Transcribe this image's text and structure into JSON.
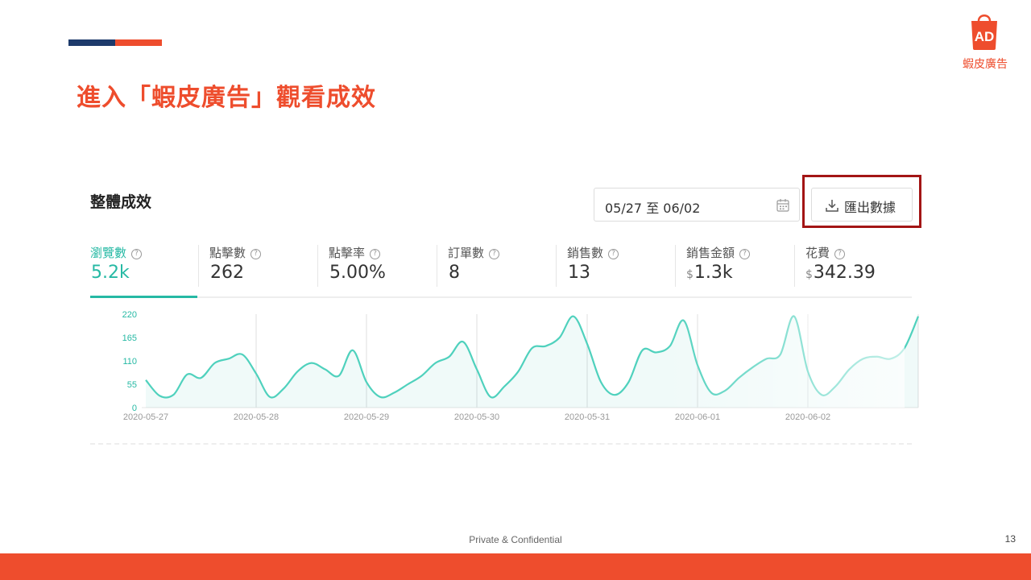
{
  "slide": {
    "title": "進入「蝦皮廣告」觀看成效",
    "logo_text": "AD",
    "logo_brand": "蝦皮廣告",
    "footer": "Private & Confidential",
    "page_number": "13",
    "colors": {
      "accent": "#ee4d2d",
      "navy": "#1d3a6b",
      "teal": "#26b9a4",
      "highlight": "#a31515"
    }
  },
  "panel": {
    "title": "整體成效",
    "date_range": "05/27 至 06/02",
    "export_label": "匯出數據",
    "icons": {
      "date": "calendar-icon",
      "export": "download-icon",
      "help": "help-circle-icon"
    }
  },
  "metrics": [
    {
      "label": "瀏覽數",
      "value": "5.2k",
      "currency": "",
      "active": true
    },
    {
      "label": "點擊數",
      "value": "262",
      "currency": "",
      "active": false
    },
    {
      "label": "點擊率",
      "value": "5.00%",
      "currency": "",
      "active": false
    },
    {
      "label": "訂單數",
      "value": "8",
      "currency": "",
      "active": false
    },
    {
      "label": "銷售數",
      "value": "13",
      "currency": "",
      "active": false
    },
    {
      "label": "銷售金額",
      "value": "1.3k",
      "currency": "$",
      "active": false
    },
    {
      "label": "花費",
      "value": "342.39",
      "currency": "$",
      "active": false
    }
  ],
  "chart_data": {
    "type": "area",
    "title": "",
    "xlabel": "",
    "ylabel": "",
    "ylim": [
      0,
      220
    ],
    "yticks": [
      0,
      55,
      110,
      165,
      220
    ],
    "xticks": [
      "2020-05-27",
      "2020-05-28",
      "2020-05-29",
      "2020-05-30",
      "2020-05-31",
      "2020-06-01",
      "2020-06-02"
    ],
    "grid": "vertical",
    "x": [
      "2020-05-27 00:00",
      "2020-05-27 03:00",
      "2020-05-27 06:00",
      "2020-05-27 09:00",
      "2020-05-27 12:00",
      "2020-05-27 15:00",
      "2020-05-27 18:00",
      "2020-05-27 21:00",
      "2020-05-28 00:00",
      "2020-05-28 03:00",
      "2020-05-28 06:00",
      "2020-05-28 09:00",
      "2020-05-28 12:00",
      "2020-05-28 15:00",
      "2020-05-28 18:00",
      "2020-05-28 21:00",
      "2020-05-29 00:00",
      "2020-05-29 03:00",
      "2020-05-29 06:00",
      "2020-05-29 09:00",
      "2020-05-29 12:00",
      "2020-05-29 15:00",
      "2020-05-29 18:00",
      "2020-05-29 21:00",
      "2020-05-30 00:00",
      "2020-05-30 03:00",
      "2020-05-30 06:00",
      "2020-05-30 09:00",
      "2020-05-30 12:00",
      "2020-05-30 15:00",
      "2020-05-30 18:00",
      "2020-05-30 21:00",
      "2020-05-31 00:00",
      "2020-05-31 03:00",
      "2020-05-31 06:00",
      "2020-05-31 09:00",
      "2020-05-31 12:00",
      "2020-05-31 15:00",
      "2020-05-31 18:00",
      "2020-05-31 21:00",
      "2020-06-01 00:00",
      "2020-06-01 03:00",
      "2020-06-01 06:00",
      "2020-06-01 09:00",
      "2020-06-01 12:00",
      "2020-06-01 15:00",
      "2020-06-01 18:00",
      "2020-06-01 21:00",
      "2020-06-02 00:00",
      "2020-06-02 03:00",
      "2020-06-02 06:00",
      "2020-06-02 09:00",
      "2020-06-02 12:00",
      "2020-06-02 15:00",
      "2020-06-02 18:00",
      "2020-06-02 21:00",
      "2020-06-03 00:00"
    ],
    "series": [
      {
        "values": [
          65,
          28,
          30,
          78,
          70,
          105,
          115,
          125,
          80,
          25,
          45,
          85,
          105,
          90,
          75,
          135,
          60,
          25,
          35,
          55,
          75,
          105,
          120,
          155,
          90,
          25,
          50,
          85,
          140,
          145,
          165,
          215,
          150,
          60,
          30,
          60,
          135,
          130,
          145,
          205,
          100,
          35,
          40,
          70,
          95,
          115,
          125,
          215,
          85,
          30,
          50,
          90,
          115,
          120,
          115,
          140,
          215
        ]
      }
    ]
  }
}
